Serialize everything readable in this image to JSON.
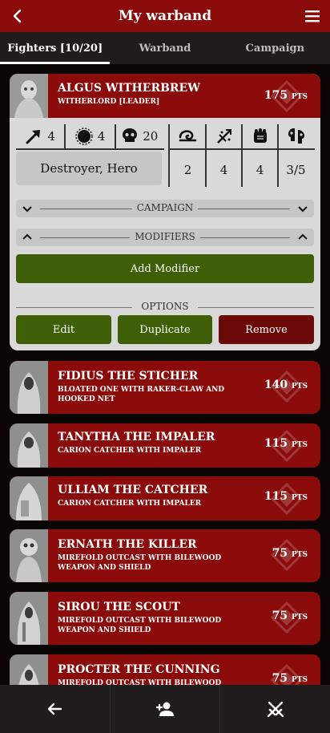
{
  "app": {
    "title": "My warband"
  },
  "tabs": [
    {
      "label": "Fighters [10/20]",
      "active": true
    },
    {
      "label": "Warband",
      "active": false
    },
    {
      "label": "Campaign",
      "active": false
    }
  ],
  "expanded_fighter": {
    "name": "ALGUS WITHERBREW",
    "type": "WITHERLORD [LEADER]",
    "points": "175",
    "points_unit": "PTS",
    "stats": {
      "move": "4",
      "toughness": "4",
      "wounds": "20"
    },
    "roles": "Destroyer, Hero",
    "weapon": {
      "range": "2",
      "attacks": "4",
      "strength": "4",
      "damage": "3/5"
    },
    "sections": {
      "campaign": "CAMPAIGN",
      "modifiers": "MODIFIERS",
      "options": "OPTIONS"
    },
    "buttons": {
      "add_modifier": "Add Modifier",
      "edit": "Edit",
      "duplicate": "Duplicate",
      "remove": "Remove"
    }
  },
  "fighters": [
    {
      "name": "FIDIUS THE STICHER",
      "type": "BLOATED ONE WITH RAKER-CLAW AND HOOKED NET",
      "points": "140",
      "unit": "PTS"
    },
    {
      "name": "TANYTHA THE IMPALER",
      "type": "CARION CATCHER WITH IMPALER",
      "points": "115",
      "unit": "PTS"
    },
    {
      "name": "ULLIAM THE CATCHER",
      "type": "CARION CATCHER WITH IMPALER",
      "points": "115",
      "unit": "PTS"
    },
    {
      "name": "ERNATH THE KILLER",
      "type": "MIREFOLD OUTCAST WITH BILEWOOD WEAPON AND SHIELD",
      "points": "75",
      "unit": "PTS"
    },
    {
      "name": "SIROU THE SCOUT",
      "type": "MIREFOLD OUTCAST WITH BILEWOOD WEAPON AND SHIELD",
      "points": "75",
      "unit": "PTS"
    },
    {
      "name": "PROCTER THE CUNNING",
      "type": "MIREFOLD OUTCAST WITH BILEWOOD",
      "points": "75",
      "unit": "PTS"
    }
  ],
  "bottom_nav": [
    "back-arrow-icon",
    "add-person-icon",
    "crossed-swords-icon"
  ],
  "colors": {
    "primary_red": "#8b0b0b",
    "green": "#3e5f08",
    "dark_red": "#6b0808",
    "panel": "#d9d9d9"
  }
}
